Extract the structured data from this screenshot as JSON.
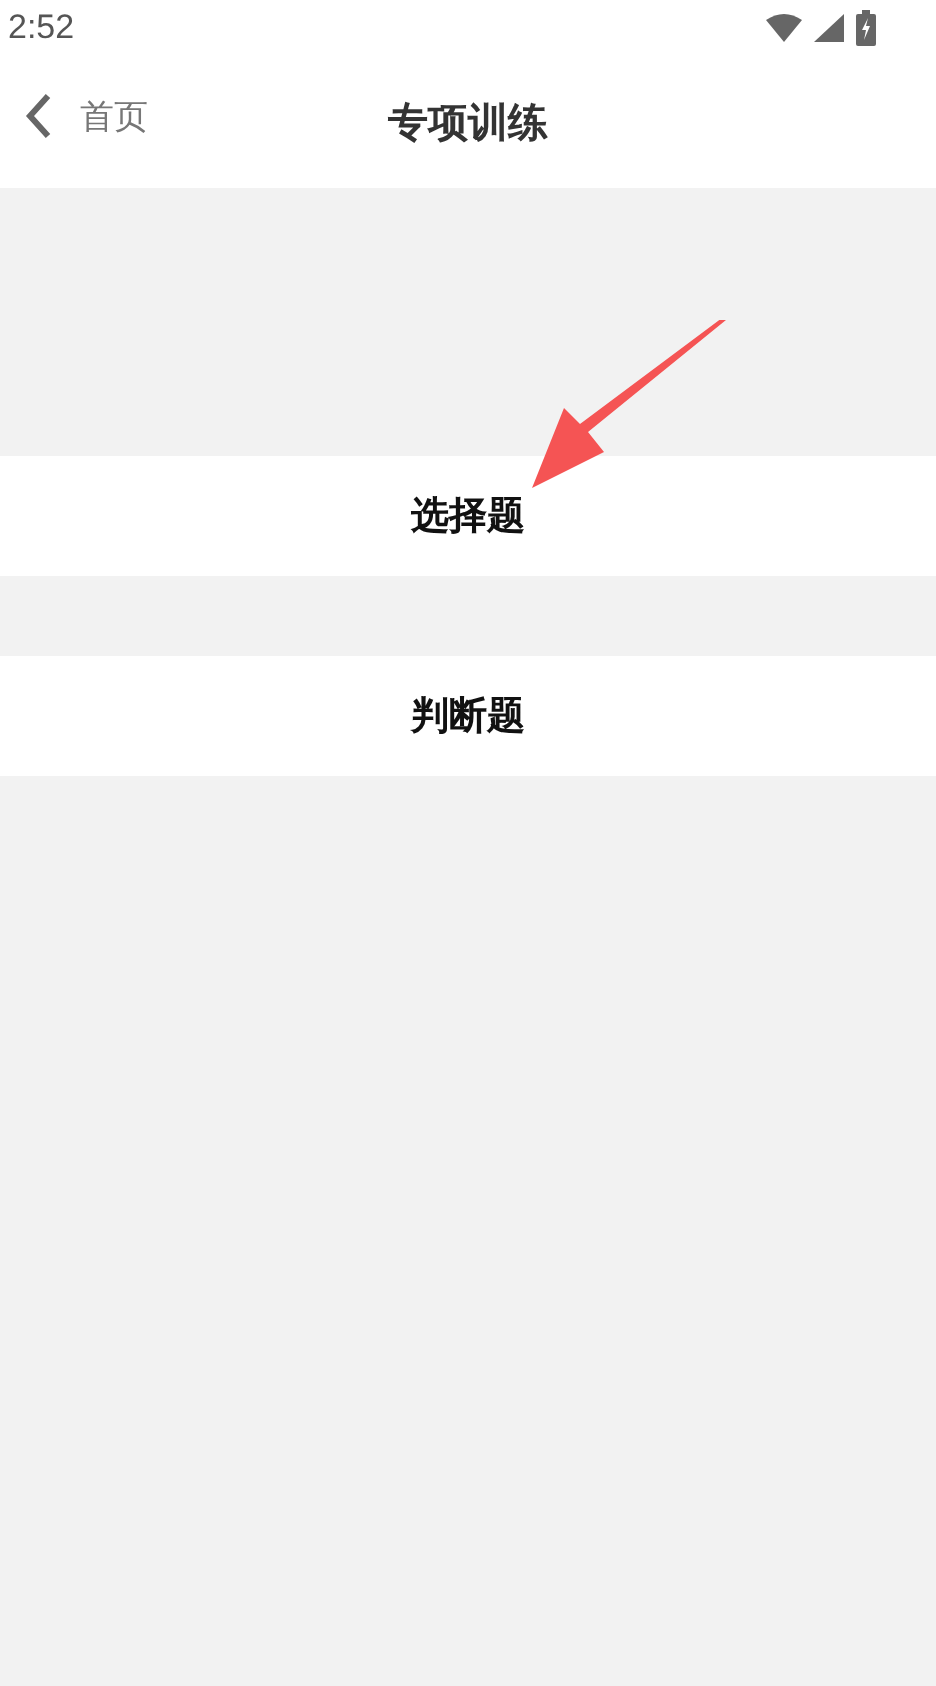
{
  "status_bar": {
    "time": "2:52"
  },
  "header": {
    "back_label": "首页",
    "title": "专项训练"
  },
  "items": [
    {
      "label": "选择题"
    },
    {
      "label": "判断题"
    }
  ],
  "annotation": {
    "kind": "arrow"
  }
}
